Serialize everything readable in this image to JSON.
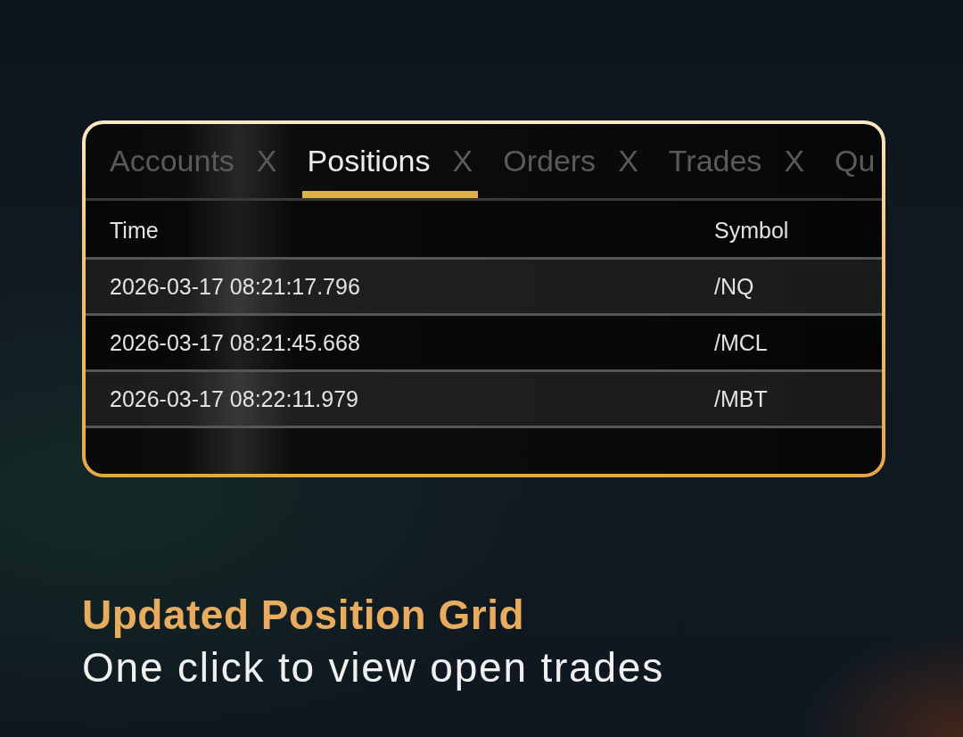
{
  "tabs": [
    {
      "label": "Accounts",
      "close": "X",
      "selected": false
    },
    {
      "label": "Positions",
      "close": "X",
      "selected": true
    },
    {
      "label": "Orders",
      "close": "X",
      "selected": false
    },
    {
      "label": "Trades",
      "close": "X",
      "selected": false
    },
    {
      "label": "Qu",
      "selected": false
    }
  ],
  "table": {
    "columns": [
      "Time",
      "Symbol"
    ],
    "rows": [
      [
        "2026-03-17 08:21:17.796",
        "/NQ"
      ],
      [
        "2026-03-17 08:21:45.668",
        "/MCL"
      ],
      [
        "2026-03-17 08:22:11.979",
        "/MBT"
      ]
    ]
  },
  "caption": {
    "title": "Updated Position Grid",
    "subtitle": "One click to view open trades"
  }
}
